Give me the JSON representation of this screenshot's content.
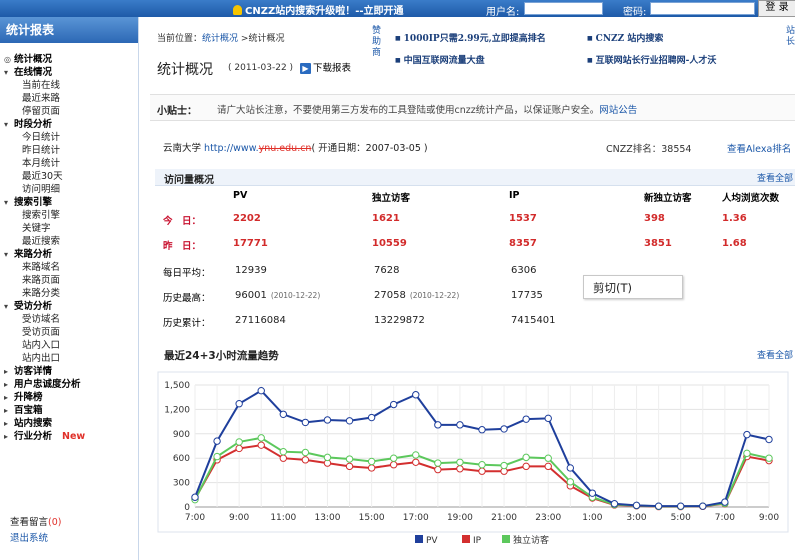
{
  "topbar": {
    "notice": "CNZZ站内搜索升级啦！--立即开通",
    "username_label": "用户名:",
    "password_label": "密码:",
    "login_button": "登 录"
  },
  "sidebar": {
    "title": "统计报表",
    "groups": [
      {
        "label": "统计概况",
        "items": []
      },
      {
        "label": "在线情况",
        "items": [
          "当前在线",
          "最近来路",
          "停留页面"
        ]
      },
      {
        "label": "时段分析",
        "items": [
          "今日统计",
          "昨日统计",
          "本月统计",
          "最近30天",
          "访问明细"
        ]
      },
      {
        "label": "搜索引擎",
        "items": [
          "搜索引擎",
          "关键字",
          "最近搜索"
        ]
      },
      {
        "label": "来路分析",
        "items": [
          "来路域名",
          "来路页面",
          "来路分类"
        ]
      },
      {
        "label": "受访分析",
        "items": [
          "受访域名",
          "受访页面",
          "站内入口",
          "站内出口"
        ]
      },
      {
        "label": "访客详情",
        "items": []
      },
      {
        "label": "用户忠诚度分析",
        "items": []
      },
      {
        "label": "升降榜",
        "items": []
      },
      {
        "label": "百宝箱",
        "items": []
      },
      {
        "label": "站内搜索",
        "items": []
      },
      {
        "label": "行业分析",
        "badge": "New",
        "items": []
      }
    ],
    "messages_label": "查看留言",
    "messages_count": "(0)",
    "logout_label": "退出系统"
  },
  "breadcrumb": {
    "prefix": "当前位置：",
    "link": "统计概况",
    "sep": " >",
    "current": "统计概况"
  },
  "page": {
    "title": "统计概况",
    "date": "( 2011-03-22 )",
    "download": "下载报表"
  },
  "sponsor_label": "赞助商",
  "ads": [
    "1000IP只需2.99元,立即提高排名",
    "CNZZ 站内搜索",
    "中国互联网流量大盘",
    "互联网站长行业招聘网-人才沃"
  ],
  "right_edge_text": "站长",
  "tip": {
    "title": "小贴士：",
    "message": "请广大站长注意，不要使用第三方发布的工具登陆或使用cnzz统计产品，以保证账户安全。",
    "link": "网站公告"
  },
  "site": {
    "name": "云南大学",
    "url_prefix": "http://www.",
    "url_redacted": "ynu.edu.cn",
    "open_date": "( 开通日期：2007-03-05 )",
    "rank": "CNZZ排名：38554",
    "alexa_link": "查看Alexa排名"
  },
  "overview": {
    "title": "访问量概况",
    "view_all": "查看全部",
    "columns": [
      "PV",
      "独立访客",
      "IP",
      "新独立访客",
      "人均浏览次数"
    ],
    "rows": [
      {
        "label": "今　日：",
        "values": [
          "2202",
          "1621",
          "1537",
          "398",
          "1.36"
        ]
      },
      {
        "label": "昨　日：",
        "values": [
          "17771",
          "10559",
          "8357",
          "3851",
          "1.68"
        ]
      },
      {
        "label": "每日平均：",
        "values": [
          "12939",
          "7628",
          "6306"
        ]
      },
      {
        "label": "历史最高：",
        "values": [
          "96001",
          "27058",
          "17735"
        ],
        "dates": [
          "(2010-12-22)",
          "(2010-12-22)"
        ]
      },
      {
        "label": "历史累计：",
        "values": [
          "27116084",
          "13229872",
          "7415401"
        ]
      }
    ]
  },
  "context_menu": {
    "item": "剪切(T)"
  },
  "trend": {
    "title": "最近24+3小时流量趋势",
    "view_all": "查看全部"
  },
  "colors": {
    "pv": "#1f3f9c",
    "ip": "#d32f2f",
    "uv": "#5cc85c",
    "accent": "#2c68b5"
  },
  "chart_data": {
    "type": "line",
    "title": "最近24+3小时流量趋势",
    "x": [
      "7:00",
      "8:00",
      "9:00",
      "10:00",
      "11:00",
      "12:00",
      "13:00",
      "14:00",
      "15:00",
      "16:00",
      "17:00",
      "18:00",
      "19:00",
      "20:00",
      "21:00",
      "22:00",
      "23:00",
      "0:00",
      "1:00",
      "2:00",
      "3:00",
      "4:00",
      "5:00",
      "6:00",
      "7:00",
      "8:00",
      "9:00"
    ],
    "xticks": [
      "7:00",
      "9:00",
      "11:00",
      "13:00",
      "15:00",
      "17:00",
      "19:00",
      "21:00",
      "23:00",
      "1:00",
      "3:00",
      "5:00",
      "7:00",
      "9:00"
    ],
    "ylim": [
      0,
      1500
    ],
    "yticks": [
      "0",
      "300",
      "600",
      "900",
      "1,200",
      "1,500"
    ],
    "grid": true,
    "legend": "bottom",
    "series": [
      {
        "name": "PV",
        "values": [
          120,
          810,
          1270,
          1430,
          1140,
          1040,
          1070,
          1060,
          1100,
          1260,
          1380,
          1010,
          1010,
          950,
          960,
          1080,
          1090,
          480,
          170,
          40,
          20,
          10,
          10,
          10,
          60,
          890,
          830
        ]
      },
      {
        "name": "IP",
        "values": [
          100,
          580,
          720,
          760,
          600,
          580,
          540,
          500,
          480,
          520,
          550,
          460,
          470,
          440,
          440,
          500,
          500,
          260,
          110,
          25,
          15,
          5,
          5,
          8,
          40,
          620,
          570
        ]
      },
      {
        "name": "独立访客",
        "values": [
          90,
          620,
          800,
          850,
          680,
          670,
          610,
          590,
          560,
          600,
          640,
          540,
          550,
          520,
          510,
          610,
          600,
          310,
          120,
          30,
          18,
          8,
          8,
          10,
          45,
          660,
          600
        ]
      }
    ]
  }
}
